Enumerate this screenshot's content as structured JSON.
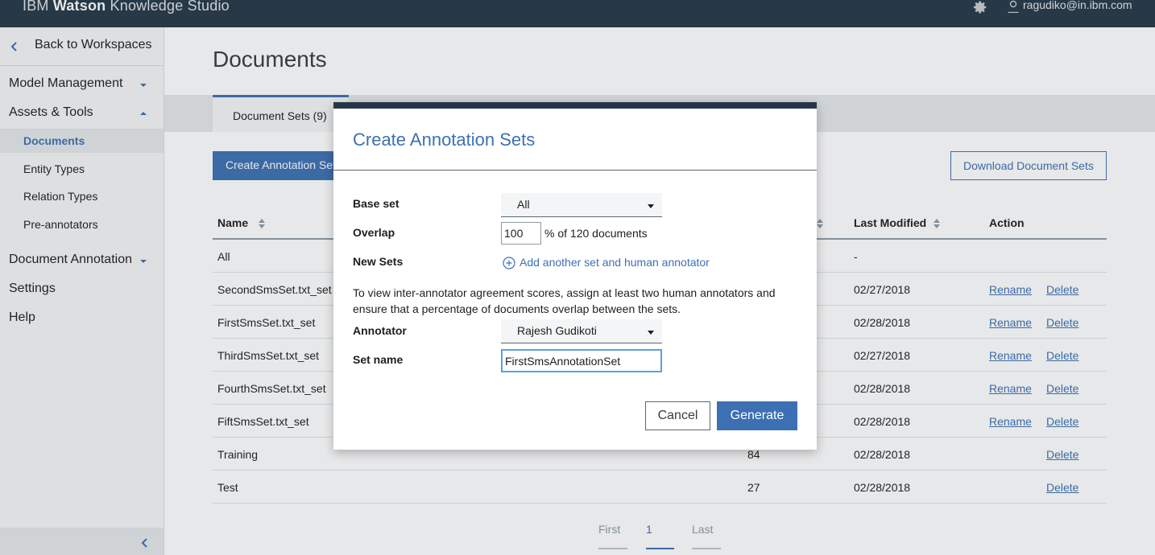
{
  "app": {
    "brand_prefix": "IBM",
    "brand_bold": "Watson",
    "brand_suffix": "Knowledge Studio",
    "user_email": "ragudiko@in.ibm.com"
  },
  "sidebar": {
    "back_label": "Back to Workspaces",
    "sections": [
      {
        "label": "Model Management"
      },
      {
        "label": "Assets & Tools"
      },
      {
        "label": "Document Annotation"
      },
      {
        "label": "Settings"
      },
      {
        "label": "Help"
      }
    ],
    "sub_items": [
      {
        "label": "Documents",
        "active": true
      },
      {
        "label": "Entity Types"
      },
      {
        "label": "Relation Types"
      },
      {
        "label": "Pre-annotators"
      }
    ]
  },
  "main": {
    "title": "Documents",
    "tab_label": "Document Sets (9)",
    "create_button": "Create Annotation Sets",
    "download_button": "Download Document Sets",
    "columns": {
      "name": "Name",
      "last_modified": "Last Modified",
      "action": "Action"
    },
    "rows": [
      {
        "name": "All",
        "count": "",
        "modified": "-",
        "rename": "",
        "delete": ""
      },
      {
        "name": "SecondSmsSet.txt_set",
        "count": "",
        "modified": "02/27/2018",
        "rename": "Rename",
        "delete": "Delete"
      },
      {
        "name": "FirstSmsSet.txt_set",
        "count": "",
        "modified": "02/28/2018",
        "rename": "Rename",
        "delete": "Delete"
      },
      {
        "name": "ThirdSmsSet.txt_set",
        "count": "",
        "modified": "02/27/2018",
        "rename": "Rename",
        "delete": "Delete"
      },
      {
        "name": "FourthSmsSet.txt_set",
        "count": "",
        "modified": "02/28/2018",
        "rename": "Rename",
        "delete": "Delete"
      },
      {
        "name": "FiftSmsSet.txt_set",
        "count": "",
        "modified": "02/28/2018",
        "rename": "Rename",
        "delete": "Delete"
      },
      {
        "name": "Training",
        "count": "84",
        "modified": "02/28/2018",
        "rename": "",
        "delete": "Delete"
      },
      {
        "name": "Test",
        "count": "27",
        "modified": "02/28/2018",
        "rename": "",
        "delete": "Delete"
      }
    ],
    "pager": {
      "first": "First",
      "current": "1",
      "last": "Last"
    }
  },
  "modal": {
    "title": "Create Annotation Sets",
    "base_set_label": "Base set",
    "base_set_value": "All",
    "overlap_label": "Overlap",
    "overlap_value": "100",
    "overlap_suffix": "% of 120 documents",
    "new_sets_label": "New Sets",
    "add_link": "Add another set and human annotator",
    "info_text": "To view inter-annotator agreement scores, assign at least two human annotators and ensure that a percentage of documents overlap between the sets.",
    "annotator_label": "Annotator",
    "annotator_value": "Rajesh Gudikoti",
    "set_name_label": "Set name",
    "set_name_value": "FirstSmsAnnotationSet",
    "cancel_label": "Cancel",
    "generate_label": "Generate"
  },
  "colors": {
    "topbar": "#253746",
    "accent": "#3d70b2",
    "sidebar_bg": "#f4f5f6"
  }
}
